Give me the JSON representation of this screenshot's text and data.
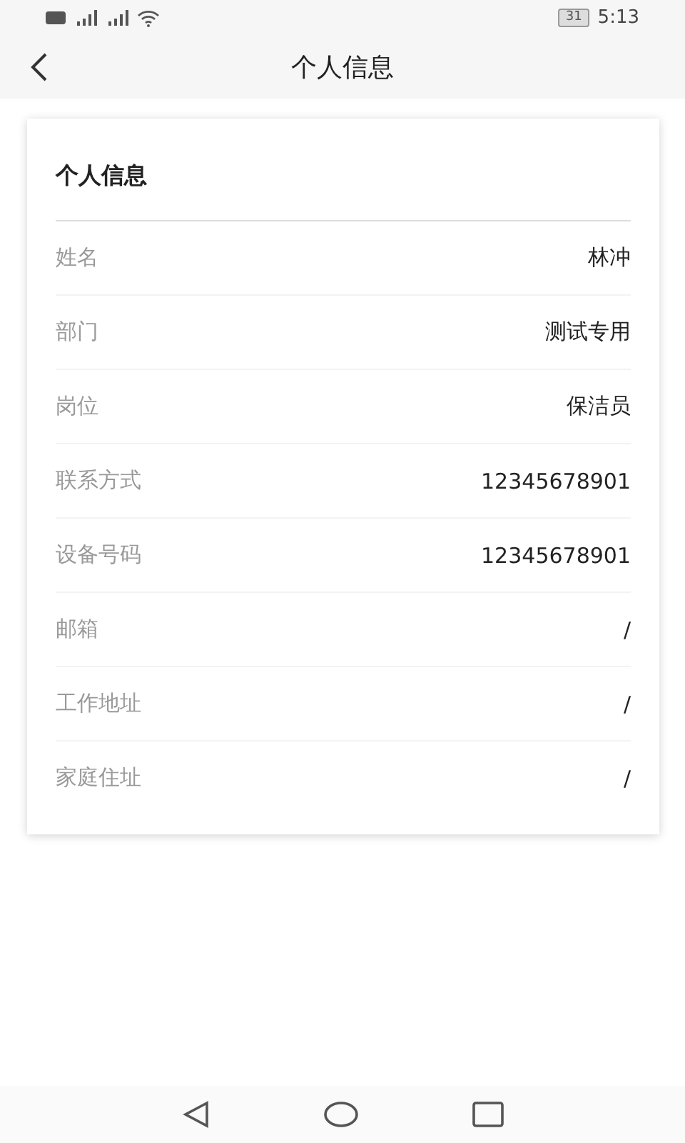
{
  "status_bar": {
    "battery": "31",
    "time": "5:13"
  },
  "header": {
    "title": "个人信息"
  },
  "card": {
    "title": "个人信息",
    "rows": [
      {
        "label": "姓名",
        "value": "林冲"
      },
      {
        "label": "部门",
        "value": "测试专用"
      },
      {
        "label": "岗位",
        "value": "保洁员"
      },
      {
        "label": "联系方式",
        "value": "12345678901"
      },
      {
        "label": "设备号码",
        "value": "12345678901"
      },
      {
        "label": "邮箱",
        "value": "/"
      },
      {
        "label": "工作地址",
        "value": "/"
      },
      {
        "label": "家庭住址",
        "value": "/"
      }
    ]
  }
}
